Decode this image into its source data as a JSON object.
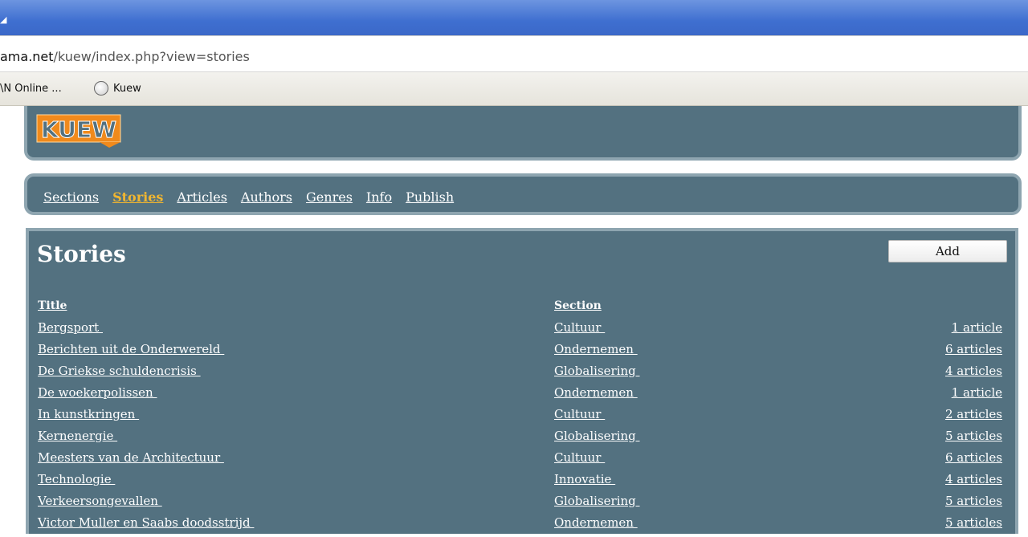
{
  "browser": {
    "url_host": "ama.net",
    "url_path": "/kuew/index.php?view=stories",
    "bookmarks": [
      "\\N Online ...",
      "Kuew"
    ]
  },
  "site": {
    "logo_text": "KUEW",
    "nav": [
      "Sections",
      "Stories",
      "Articles",
      "Authors",
      "Genres",
      "Info",
      "Publish"
    ],
    "active_nav": "Stories"
  },
  "page": {
    "title": "Stories",
    "add_label": "Add",
    "columns": {
      "title": "Title",
      "section": "Section"
    },
    "rows": [
      {
        "title": "Bergsport ",
        "section": "Cultuur ",
        "count": "1 article"
      },
      {
        "title": "Berichten uit de Onderwereld ",
        "section": "Ondernemen ",
        "count": "6 articles"
      },
      {
        "title": "De Griekse schuldencrisis ",
        "section": "Globalisering ",
        "count": "4 articles"
      },
      {
        "title": "De woekerpolissen ",
        "section": "Ondernemen ",
        "count": "1 article"
      },
      {
        "title": "In kunstkringen ",
        "section": "Cultuur ",
        "count": "2 articles"
      },
      {
        "title": "Kernenergie ",
        "section": "Globalisering ",
        "count": "5 articles"
      },
      {
        "title": "Meesters van de Architectuur ",
        "section": "Cultuur ",
        "count": "6 articles"
      },
      {
        "title": "Technologie ",
        "section": "Innovatie ",
        "count": "4 articles"
      },
      {
        "title": "Verkeersongevallen ",
        "section": "Globalisering ",
        "count": "5 articles"
      },
      {
        "title": "Victor Muller en Saabs doodsstrijd ",
        "section": "Ondernemen ",
        "count": "5 articles"
      }
    ]
  },
  "colors": {
    "panel": "#537180",
    "panel_border": "#8ea5b0",
    "active_nav": "#f1b630",
    "logo_orange": "#f08a1c",
    "titlebar": "#3f6fd0"
  }
}
